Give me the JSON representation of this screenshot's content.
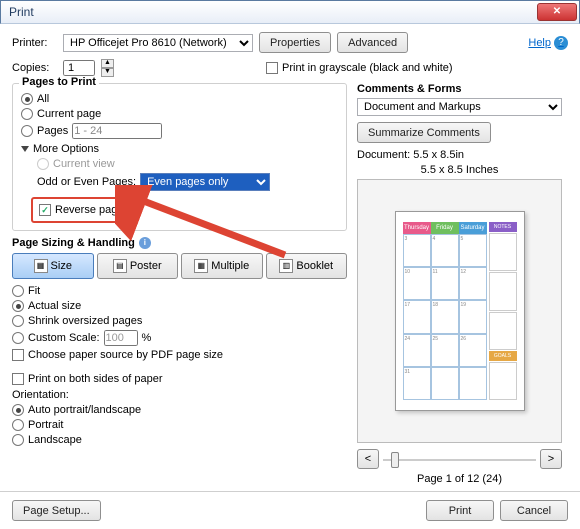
{
  "window": {
    "title": "Print"
  },
  "header": {
    "printer_label": "Printer:",
    "printer_value": "HP Officejet Pro 8610 (Network)",
    "properties_btn": "Properties",
    "advanced_btn": "Advanced",
    "help_label": "Help",
    "copies_label": "Copies:",
    "copies_value": "1",
    "grayscale_label": "Print in grayscale (black and white)"
  },
  "pages": {
    "title": "Pages to Print",
    "all": "All",
    "current": "Current page",
    "pages_label": "Pages",
    "pages_value": "1 - 24",
    "more_options": "More Options",
    "current_view": "Current view",
    "odd_even_label": "Odd or Even Pages:",
    "odd_even_value": "Even pages only",
    "reverse": "Reverse pages"
  },
  "sizing": {
    "title": "Page Sizing & Handling",
    "size_btn": "Size",
    "poster_btn": "Poster",
    "multiple_btn": "Multiple",
    "booklet_btn": "Booklet",
    "fit": "Fit",
    "actual": "Actual size",
    "shrink": "Shrink oversized pages",
    "custom_scale": "Custom Scale:",
    "custom_value": "100",
    "percent": "%",
    "paper_source": "Choose paper source by PDF page size",
    "both_sides": "Print on both sides of paper",
    "orientation_label": "Orientation:",
    "auto": "Auto portrait/landscape",
    "portrait": "Portrait",
    "landscape": "Landscape"
  },
  "comments": {
    "title": "Comments & Forms",
    "dropdown_value": "Document and Markups",
    "summarize_btn": "Summarize Comments",
    "doc_size": "Document: 5.5 x 8.5in",
    "preview_size": "5.5 x 8.5 Inches",
    "cal_headers": [
      "Thursday",
      "Friday",
      "Saturday"
    ],
    "notes_label": "NOTES",
    "goals_label": "GOALS",
    "page_info": "Page 1 of 12 (24)"
  },
  "footer": {
    "page_setup": "Page Setup...",
    "print_btn": "Print",
    "cancel_btn": "Cancel"
  },
  "colors": {
    "thu": "#e85a8a",
    "fri": "#6fbf5e",
    "sat": "#4a9ed8",
    "notes": "#8a5fc7",
    "goals": "#e6a845"
  }
}
